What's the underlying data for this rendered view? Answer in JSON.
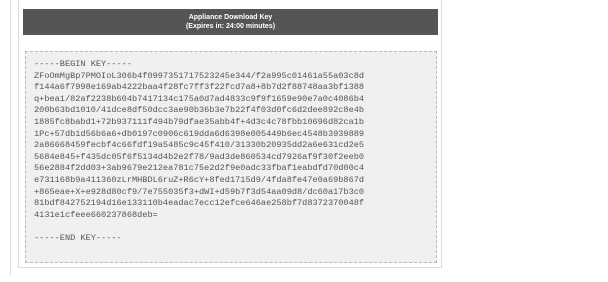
{
  "header": {
    "title": "Appliance Download Key",
    "subtitle": "(Expires in: 24:00 minutes)"
  },
  "key": {
    "lines": [
      "-----BEGIN KEY-----",
      "ZFoOmMgBp7PMOIoL306b4f0997351717523245e344/f2a995c01461a55a03c8d",
      "f144a6f7998e169ab4222baa4f28fc7ff3f22fcd7a8+8b7d2f88748aa3bf1388",
      "q+bea1/82af2238b604b7417134c175a0d7ad4833c9f9f1659e90e7a0c4086b4",
      "200b63bd1010/41dce8df50dcc3ae90b36b3e7b22f4f03d0fc6d2dee892c8e4b",
      "1885fc8babd1+72b937111f494b79dfae35abb4f+4d3c4c78fbb10696d82ca1b",
      "1Pc+57db1d56b6a6+db0197c0906c619dda6d6398e005449b6ec4548b3939889",
      "2a86668459fecbf4c66fdf19a5485c9c45f410/31330b20935dd2a6e631cd2e5",
      "5684e845+f435dc05f6f5134d4b2e2f78/9ad3de860534cd7926af9f30f2eeb0",
      "56e2884f2dd03+3ab9679e212ea781c75e2d2f9e0adc33fbaf1eabdfd70d00c4",
      "e731168b9a411360zLrMHBDL6ruZ+R6cY+8fed1715d9/4fda8fe47e0a69b867d",
      "+865eae+X+e928d80cf9/7e755035f3+dWI+d59b7f3d54aa09d8/dc60a17b3c0",
      "81bdf842752194d16e133110b4eadac7ecc12efce646ae258bf7d8372370048f",
      "4131e1cfeee660237868deb=",
      "",
      "-----END KEY-----"
    ]
  }
}
